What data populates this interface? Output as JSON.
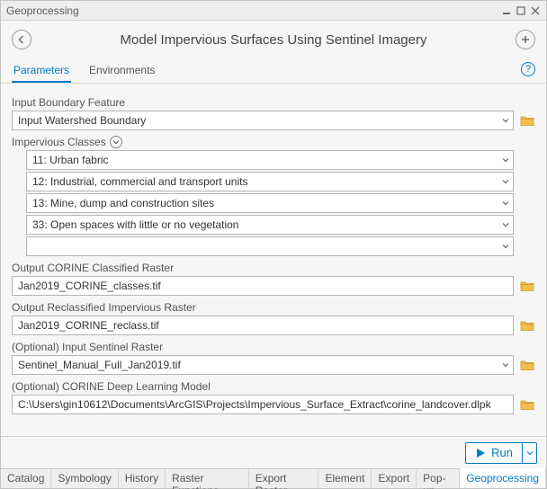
{
  "window": {
    "title": "Geoprocessing"
  },
  "header": {
    "tool_title": "Model Impervious Surfaces Using Sentinel Imagery"
  },
  "tabs": {
    "parameters": "Parameters",
    "environments": "Environments"
  },
  "params": {
    "boundary_label": "Input Boundary Feature",
    "boundary_value": "Input Watershed Boundary",
    "classes_label": "Impervious Classes",
    "classes": [
      "11: Urban fabric",
      "12: Industrial, commercial and transport units",
      "13: Mine, dump and construction sites",
      "33: Open spaces with little or no vegetation",
      ""
    ],
    "out_corine_label": "Output CORINE Classified Raster",
    "out_corine_value": "Jan2019_CORINE_classes.tif",
    "out_reclass_label": "Output Reclassified Impervious Raster",
    "out_reclass_value": "Jan2019_CORINE_reclass.tif",
    "opt_sentinel_label": "(Optional) Input Sentinel Raster",
    "opt_sentinel_value": "Sentinel_Manual_Full_Jan2019.tif",
    "opt_model_label": "(Optional) CORINE Deep Learning Model",
    "opt_model_value": "C:\\Users\\gin10612\\Documents\\ArcGIS\\Projects\\Impervious_Surface_Extract\\corine_landcover.dlpk"
  },
  "run": {
    "label": "Run"
  },
  "bottom_tabs": [
    "Catalog",
    "Symbology",
    "History",
    "Raster Functions",
    "Export Raster",
    "Element",
    "Export",
    "Pop-up",
    "Geoprocessing"
  ]
}
